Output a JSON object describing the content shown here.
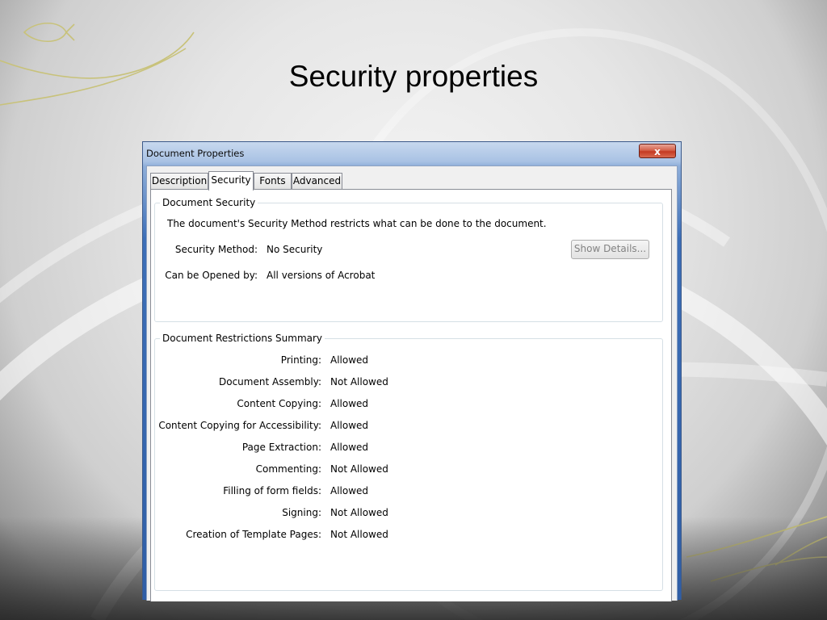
{
  "slide": {
    "title": "Security properties"
  },
  "window": {
    "title": "Document Properties",
    "close_glyph": "x"
  },
  "tabs": [
    {
      "label": "Description",
      "active": false
    },
    {
      "label": "Security",
      "active": true
    },
    {
      "label": "Fonts",
      "active": false
    },
    {
      "label": "Advanced",
      "active": false
    }
  ],
  "document_security": {
    "group_title": "Document Security",
    "description": "The document's Security Method restricts what can be done to the document.",
    "security_method_label": "Security Method:",
    "security_method_value": "No Security",
    "opened_by_label": "Can be Opened by:",
    "opened_by_value": "All versions of Acrobat",
    "show_details_label": "Show Details..."
  },
  "restrictions": {
    "group_title": "Document Restrictions Summary",
    "rows": [
      {
        "label": "Printing:",
        "value": "Allowed"
      },
      {
        "label": "Document Assembly:",
        "value": "Not Allowed"
      },
      {
        "label": "Content Copying:",
        "value": "Allowed"
      },
      {
        "label": "Content Copying for Accessibility:",
        "value": "Allowed"
      },
      {
        "label": "Page Extraction:",
        "value": "Allowed"
      },
      {
        "label": "Commenting:",
        "value": "Not Allowed"
      },
      {
        "label": "Filling of form fields:",
        "value": "Allowed"
      },
      {
        "label": "Signing:",
        "value": "Not Allowed"
      },
      {
        "label": "Creation of Template Pages:",
        "value": "Not Allowed"
      }
    ]
  },
  "colors": {
    "title_bar": "#a9c2e4",
    "close_button": "#c43a22",
    "accent_gold": "#c8c27a"
  }
}
